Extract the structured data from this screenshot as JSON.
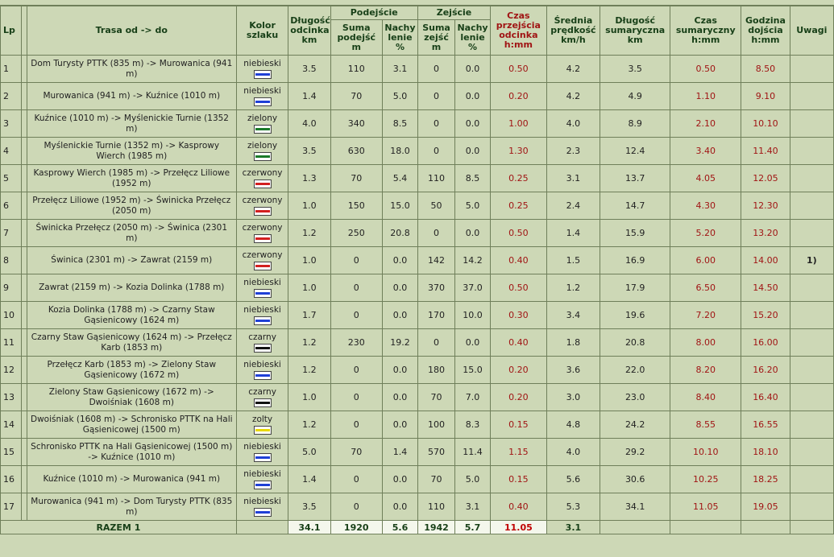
{
  "headers": {
    "lp": "Lp",
    "trasa": "Trasa od -> do",
    "kolor": "Kolor szlaku",
    "dlugosc_odcinka": "Długość odcinka km",
    "podejscie": "Podejście",
    "suma_podejsc": "Suma podejść m",
    "nachylenie": "Nachy lenie %",
    "zejscie": "Zejście",
    "suma_zejsc": "Suma zejść m",
    "czas_przejscia": "Czas przejścia odcinka h:mm",
    "srednia_predkosc": "Średnia prędkość km/h",
    "dlugosc_sumaryczna": "Długość sumaryczna km",
    "czas_sumaryczny": "Czas sumaryczny h:mm",
    "godzina_dojscia": "Godzina dojścia h:mm",
    "uwagi": "Uwagi"
  },
  "colors": {
    "niebieski": "#1f3fd6",
    "zielony": "#1a7a2a",
    "czerwony": "#d21f1f",
    "czarny": "#111111",
    "zolty": "#e8d800"
  },
  "rows": [
    {
      "lp": "1",
      "trasa": "Dom Turysty PTTK (835 m) -> Murowanica (941 m)",
      "kolor": "niebieski",
      "dl": "3.5",
      "sp": "110",
      "np": "3.1",
      "sz": "0",
      "nz": "0.0",
      "czas": "0.50",
      "sr": "4.2",
      "dls": "3.5",
      "czs": "0.50",
      "godz": "8.50",
      "uw": ""
    },
    {
      "lp": "2",
      "trasa": "Murowanica (941 m) -> Kuźnice (1010 m)",
      "kolor": "niebieski",
      "dl": "1.4",
      "sp": "70",
      "np": "5.0",
      "sz": "0",
      "nz": "0.0",
      "czas": "0.20",
      "sr": "4.2",
      "dls": "4.9",
      "czs": "1.10",
      "godz": "9.10",
      "uw": ""
    },
    {
      "lp": "3",
      "trasa": "Kuźnice (1010 m) -> Myślenickie Turnie (1352 m)",
      "kolor": "zielony",
      "dl": "4.0",
      "sp": "340",
      "np": "8.5",
      "sz": "0",
      "nz": "0.0",
      "czas": "1.00",
      "sr": "4.0",
      "dls": "8.9",
      "czs": "2.10",
      "godz": "10.10",
      "uw": ""
    },
    {
      "lp": "4",
      "trasa": "Myślenickie Turnie (1352 m) -> Kasprowy Wierch (1985 m)",
      "kolor": "zielony",
      "dl": "3.5",
      "sp": "630",
      "np": "18.0",
      "sz": "0",
      "nz": "0.0",
      "czas": "1.30",
      "sr": "2.3",
      "dls": "12.4",
      "czs": "3.40",
      "godz": "11.40",
      "uw": ""
    },
    {
      "lp": "5",
      "trasa": "Kasprowy Wierch (1985 m) -> Przełęcz Liliowe (1952 m)",
      "kolor": "czerwony",
      "dl": "1.3",
      "sp": "70",
      "np": "5.4",
      "sz": "110",
      "nz": "8.5",
      "czas": "0.25",
      "sr": "3.1",
      "dls": "13.7",
      "czs": "4.05",
      "godz": "12.05",
      "uw": ""
    },
    {
      "lp": "6",
      "trasa": "Przełęcz Liliowe (1952 m) -> Świnicka Przełęcz (2050 m)",
      "kolor": "czerwony",
      "dl": "1.0",
      "sp": "150",
      "np": "15.0",
      "sz": "50",
      "nz": "5.0",
      "czas": "0.25",
      "sr": "2.4",
      "dls": "14.7",
      "czs": "4.30",
      "godz": "12.30",
      "uw": ""
    },
    {
      "lp": "7",
      "trasa": "Świnicka Przełęcz (2050 m) -> Świnica (2301 m)",
      "kolor": "czerwony",
      "dl": "1.2",
      "sp": "250",
      "np": "20.8",
      "sz": "0",
      "nz": "0.0",
      "czas": "0.50",
      "sr": "1.4",
      "dls": "15.9",
      "czs": "5.20",
      "godz": "13.20",
      "uw": ""
    },
    {
      "lp": "8",
      "trasa": "Świnica (2301 m) -> Zawrat (2159 m)",
      "kolor": "czerwony",
      "dl": "1.0",
      "sp": "0",
      "np": "0.0",
      "sz": "142",
      "nz": "14.2",
      "czas": "0.40",
      "sr": "1.5",
      "dls": "16.9",
      "czs": "6.00",
      "godz": "14.00",
      "uw": "1)"
    },
    {
      "lp": "9",
      "trasa": "Zawrat (2159 m) -> Kozia Dolinka (1788 m)",
      "kolor": "niebieski",
      "dl": "1.0",
      "sp": "0",
      "np": "0.0",
      "sz": "370",
      "nz": "37.0",
      "czas": "0.50",
      "sr": "1.2",
      "dls": "17.9",
      "czs": "6.50",
      "godz": "14.50",
      "uw": ""
    },
    {
      "lp": "10",
      "trasa": "Kozia Dolinka (1788 m) -> Czarny Staw Gąsienicowy (1624 m)",
      "kolor": "niebieski",
      "dl": "1.7",
      "sp": "0",
      "np": "0.0",
      "sz": "170",
      "nz": "10.0",
      "czas": "0.30",
      "sr": "3.4",
      "dls": "19.6",
      "czs": "7.20",
      "godz": "15.20",
      "uw": ""
    },
    {
      "lp": "11",
      "trasa": "Czarny Staw Gąsienicowy (1624 m) -> Przełęcz Karb (1853 m)",
      "kolor": "czarny",
      "dl": "1.2",
      "sp": "230",
      "np": "19.2",
      "sz": "0",
      "nz": "0.0",
      "czas": "0.40",
      "sr": "1.8",
      "dls": "20.8",
      "czs": "8.00",
      "godz": "16.00",
      "uw": ""
    },
    {
      "lp": "12",
      "trasa": "Przełęcz Karb (1853 m) -> Zielony Staw Gąsienicowy (1672 m)",
      "kolor": "niebieski",
      "dl": "1.2",
      "sp": "0",
      "np": "0.0",
      "sz": "180",
      "nz": "15.0",
      "czas": "0.20",
      "sr": "3.6",
      "dls": "22.0",
      "czs": "8.20",
      "godz": "16.20",
      "uw": ""
    },
    {
      "lp": "13",
      "trasa": "Zielony Staw Gąsienicowy (1672 m) -> Dwoiśniak (1608 m)",
      "kolor": "czarny",
      "dl": "1.0",
      "sp": "0",
      "np": "0.0",
      "sz": "70",
      "nz": "7.0",
      "czas": "0.20",
      "sr": "3.0",
      "dls": "23.0",
      "czs": "8.40",
      "godz": "16.40",
      "uw": ""
    },
    {
      "lp": "14",
      "trasa": "Dwoiśniak (1608 m) -> Schronisko PTTK na Hali Gąsienicowej (1500 m)",
      "kolor": "zolty",
      "dl": "1.2",
      "sp": "0",
      "np": "0.0",
      "sz": "100",
      "nz": "8.3",
      "czas": "0.15",
      "sr": "4.8",
      "dls": "24.2",
      "czs": "8.55",
      "godz": "16.55",
      "uw": ""
    },
    {
      "lp": "15",
      "trasa": "Schronisko PTTK na Hali Gąsienicowej (1500 m) -> Kuźnice (1010 m)",
      "kolor": "niebieski",
      "dl": "5.0",
      "sp": "70",
      "np": "1.4",
      "sz": "570",
      "nz": "11.4",
      "czas": "1.15",
      "sr": "4.0",
      "dls": "29.2",
      "czs": "10.10",
      "godz": "18.10",
      "uw": ""
    },
    {
      "lp": "16",
      "trasa": "Kuźnice (1010 m) -> Murowanica (941 m)",
      "kolor": "niebieski",
      "dl": "1.4",
      "sp": "0",
      "np": "0.0",
      "sz": "70",
      "nz": "5.0",
      "czas": "0.15",
      "sr": "5.6",
      "dls": "30.6",
      "czs": "10.25",
      "godz": "18.25",
      "uw": ""
    },
    {
      "lp": "17",
      "trasa": "Murowanica (941 m) -> Dom Turysty PTTK (835 m)",
      "kolor": "niebieski",
      "dl": "3.5",
      "sp": "0",
      "np": "0.0",
      "sz": "110",
      "nz": "3.1",
      "czas": "0.40",
      "sr": "5.3",
      "dls": "34.1",
      "czs": "11.05",
      "godz": "19.05",
      "uw": ""
    }
  ],
  "total": {
    "label": "RAZEM 1",
    "dl": "34.1",
    "sp": "1920",
    "np": "5.6",
    "sz": "1942",
    "nz": "5.7",
    "czas": "11.05",
    "sr": "3.1"
  }
}
